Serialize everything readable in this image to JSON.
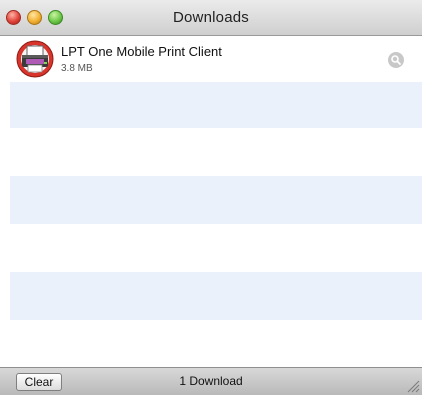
{
  "window": {
    "title": "Downloads"
  },
  "downloads": [
    {
      "name": "LPT One Mobile Print Client",
      "size": "3.8 MB",
      "icon": "printer-app-icon",
      "action_icon": "magnifier-icon"
    }
  ],
  "bottom_bar": {
    "clear_label": "Clear",
    "status": "1 Download"
  },
  "colors": {
    "stripe_alt": "#eaf1fb",
    "icon_red": "#d9342b"
  }
}
